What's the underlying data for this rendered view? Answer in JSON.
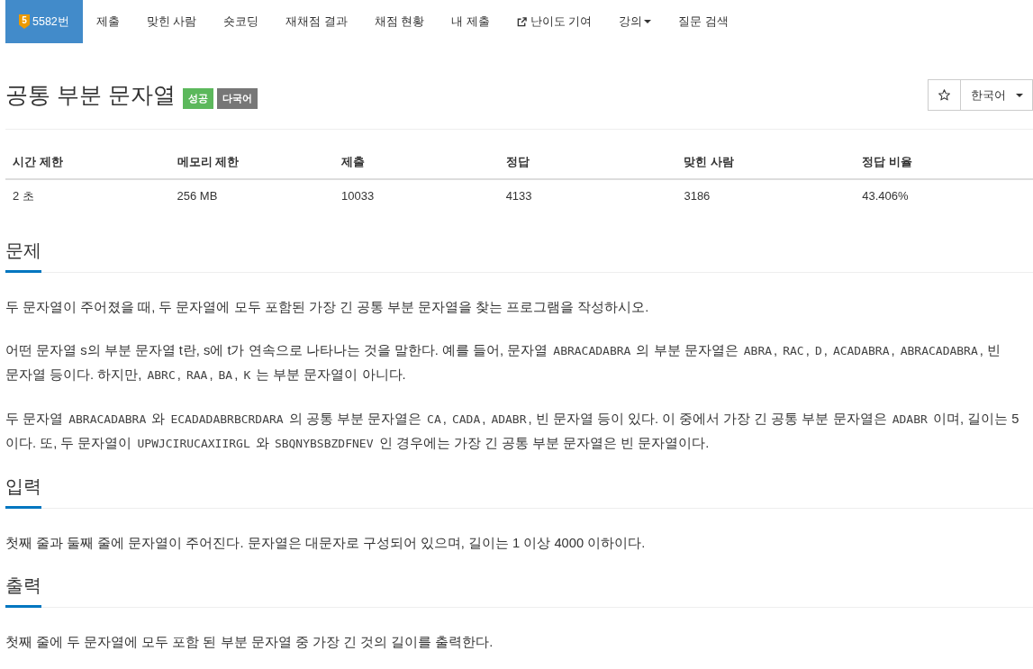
{
  "nav": {
    "tabs": [
      {
        "kind": "problem",
        "label": "5582번",
        "tier": "5",
        "selected": true
      },
      {
        "kind": "link",
        "label": "제출",
        "selected": false
      },
      {
        "kind": "link",
        "label": "맞힌 사람",
        "selected": false
      },
      {
        "kind": "link",
        "label": "숏코딩",
        "selected": false
      },
      {
        "kind": "link",
        "label": "재채점 결과",
        "selected": false
      },
      {
        "kind": "link",
        "label": "채점 현황",
        "selected": false
      },
      {
        "kind": "link",
        "label": "내 제출",
        "selected": false
      },
      {
        "kind": "external",
        "label": "난이도 기여",
        "selected": false
      },
      {
        "kind": "dropdown",
        "label": "강의",
        "selected": false
      },
      {
        "kind": "link",
        "label": "질문 검색",
        "selected": false
      }
    ]
  },
  "problem": {
    "title": "공통 부분 문자열",
    "labels": [
      {
        "text": "성공",
        "color": "#5cb85c"
      },
      {
        "text": "다국어",
        "color": "#777777"
      }
    ]
  },
  "toolbar": {
    "starred": false,
    "language": "한국어"
  },
  "info_table": {
    "columns": [
      "시간 제한",
      "메모리 제한",
      "제출",
      "정답",
      "맞힌 사람",
      "정답 비율"
    ],
    "rows": [
      [
        "2 초",
        "256 MB",
        "10033",
        "4133",
        "3186",
        "43.406%"
      ]
    ]
  },
  "sections": [
    {
      "title": "문제",
      "paragraphs": [
        [
          {
            "kind": "text",
            "text": "두 문자열이 주어졌을 때, 두 문자열에 모두 포함된 가장 긴 공통 부분 문자열을 찾는 프로그램을 작성하시오."
          }
        ],
        [
          {
            "kind": "text",
            "text": "어떤 문자열 s의 부분 문자열 t란, s에 t가 연속으로 나타나는 것을 말한다. 예를 들어, 문자열 "
          },
          {
            "kind": "code",
            "text": "ABRACADABRA"
          },
          {
            "kind": "text",
            "text": " 의 부분 문자열은 "
          },
          {
            "kind": "code",
            "text": "ABRA"
          },
          {
            "kind": "text",
            "text": ", "
          },
          {
            "kind": "code",
            "text": "RAC"
          },
          {
            "kind": "text",
            "text": ", "
          },
          {
            "kind": "code",
            "text": "D"
          },
          {
            "kind": "text",
            "text": ", "
          },
          {
            "kind": "code",
            "text": "ACADABRA"
          },
          {
            "kind": "text",
            "text": ", "
          },
          {
            "kind": "code",
            "text": "ABRACADABRA"
          },
          {
            "kind": "text",
            "text": ", 빈 문자열 등이다. 하지만, "
          },
          {
            "kind": "code",
            "text": "ABRC"
          },
          {
            "kind": "text",
            "text": ", "
          },
          {
            "kind": "code",
            "text": "RAA"
          },
          {
            "kind": "text",
            "text": ", "
          },
          {
            "kind": "code",
            "text": "BA"
          },
          {
            "kind": "text",
            "text": ", "
          },
          {
            "kind": "code",
            "text": "K"
          },
          {
            "kind": "text",
            "text": " 는 부분 문자열이 아니다."
          }
        ],
        [
          {
            "kind": "text",
            "text": "두 문자열 "
          },
          {
            "kind": "code",
            "text": "ABRACADABRA"
          },
          {
            "kind": "text",
            "text": " 와 "
          },
          {
            "kind": "code",
            "text": "ECADADABRBCRDARA"
          },
          {
            "kind": "text",
            "text": " 의 공통 부분 문자열은 "
          },
          {
            "kind": "code",
            "text": "CA"
          },
          {
            "kind": "text",
            "text": ", "
          },
          {
            "kind": "code",
            "text": "CADA"
          },
          {
            "kind": "text",
            "text": ", "
          },
          {
            "kind": "code",
            "text": "ADABR"
          },
          {
            "kind": "text",
            "text": ", 빈 문자열 등이 있다. 이 중에서 가장 긴 공통 부분 문자열은 "
          },
          {
            "kind": "code",
            "text": "ADABR"
          },
          {
            "kind": "text",
            "text": " 이며, 길이는 5 이다. 또, 두 문자열이 "
          },
          {
            "kind": "code",
            "text": "UPWJCIRUCAXIIRGL"
          },
          {
            "kind": "text",
            "text": " 와 "
          },
          {
            "kind": "code",
            "text": "SBQNYBSBZDFNEV"
          },
          {
            "kind": "text",
            "text": " 인 경우에는 가장 긴 공통 부분 문자열은 빈 문자열이다."
          }
        ]
      ]
    },
    {
      "title": "입력",
      "paragraphs": [
        [
          {
            "kind": "text",
            "text": "첫째 줄과 둘째 줄에 문자열이 주어진다. 문자열은 대문자로 구성되어 있으며, 길이는 1 이상 4000 이하이다."
          }
        ]
      ]
    },
    {
      "title": "출력",
      "paragraphs": [
        [
          {
            "kind": "text",
            "text": "첫째 줄에 두 문자열에 모두 포함 된 부분 문자열 중 가장 긴 것의 길이를 출력한다."
          }
        ]
      ]
    }
  ]
}
